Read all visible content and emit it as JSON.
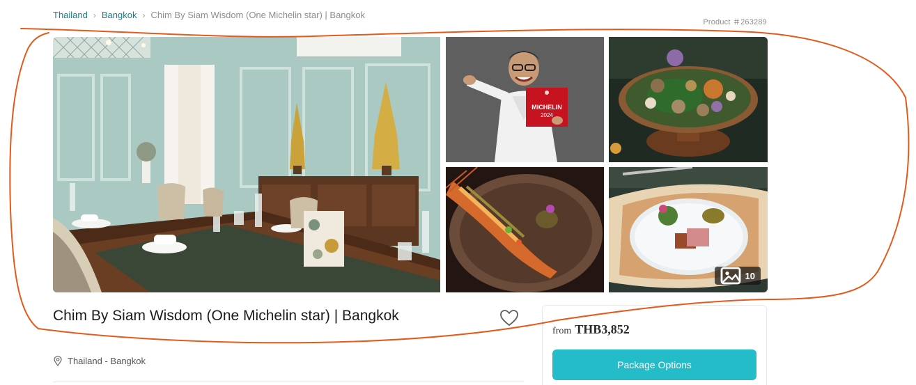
{
  "breadcrumb": {
    "items": [
      {
        "label": "Thailand"
      },
      {
        "label": "Bangkok"
      },
      {
        "label": "Chim By Siam Wisdom (One Michelin star) | Bangkok"
      }
    ],
    "separator": "›"
  },
  "product": {
    "id_label": "Product ＃263289"
  },
  "gallery": {
    "photos": [
      {
        "subject": "dining-room"
      },
      {
        "subject": "chef-with-michelin-plaque",
        "plaque_line1": "MICHELIN",
        "plaque_line2": "2024"
      },
      {
        "subject": "appetizer-platter"
      },
      {
        "subject": "prawn-dish"
      },
      {
        "subject": "duck-main-course"
      }
    ],
    "photo_count": "10",
    "photo_count_icon": "image-icon"
  },
  "listing": {
    "title": "Chim By Siam Wisdom (One Michelin star) | Bangkok",
    "favorite_icon": "heart-icon",
    "location_icon": "map-pin-icon",
    "location": "Thailand - Bangkok"
  },
  "pricing": {
    "from_label": "from",
    "price": "THB3,852",
    "cta_label": "Package Options"
  },
  "colors": {
    "link": "#1a7f8a",
    "cta": "#23bcc8",
    "annotation": "#e35b1c"
  }
}
